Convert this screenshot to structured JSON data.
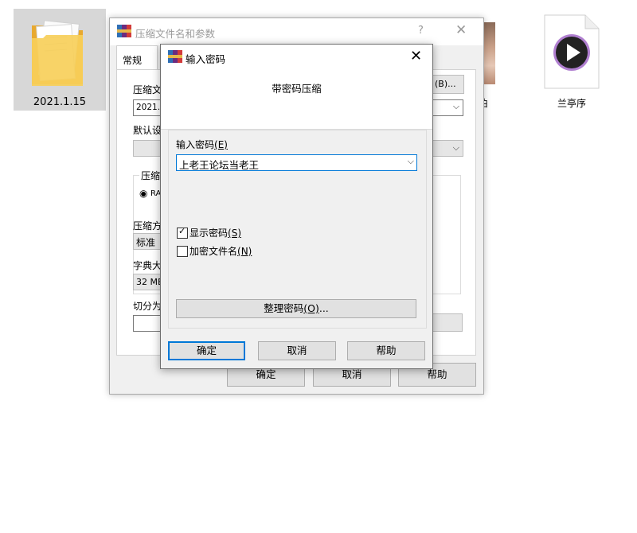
{
  "desktop": {
    "folder_label": "2021.1.15",
    "file_label": "兰亭序",
    "peek_label": "伯"
  },
  "back_dialog": {
    "title": "压缩文件名和参数",
    "help": "?",
    "close": "✕",
    "tab_general": "常规",
    "archive_name_label": "压缩文",
    "archive_name_value": "2021.1",
    "browse_button": "(B)...",
    "default_profile_label": "默认设",
    "format_group_label": "压缩",
    "format_option": "RA",
    "method_label": "压缩方",
    "method_value": "标准",
    "dict_label": "字典大",
    "dict_value": "32 MB",
    "split_label": "切分为",
    "paren_peek": ")",
    "ok": "确定",
    "cancel": "取消",
    "help_button": "帮助"
  },
  "front_dialog": {
    "title": "输入密码",
    "close": "✕",
    "heading": "带密码压缩",
    "password_label": "输入密码",
    "password_key": "(E)",
    "password_value": "上老王论坛当老王",
    "show_password_label": "显示密码",
    "show_password_key": "(S)",
    "show_password_checked": true,
    "encrypt_names_label": "加密文件名",
    "encrypt_names_key": "(N)",
    "encrypt_names_checked": false,
    "organize_label": "整理密码",
    "organize_key": "(O)",
    "organize_suffix": "...",
    "ok": "确定",
    "cancel": "取消",
    "help": "帮助"
  },
  "icons": {
    "winrar": "winrar-icon",
    "folder": "folder-icon",
    "media_file": "media-file-icon"
  },
  "colors": {
    "accent": "#0078d7",
    "folder": "#f3c242",
    "media_ring": "#9b59b6"
  }
}
